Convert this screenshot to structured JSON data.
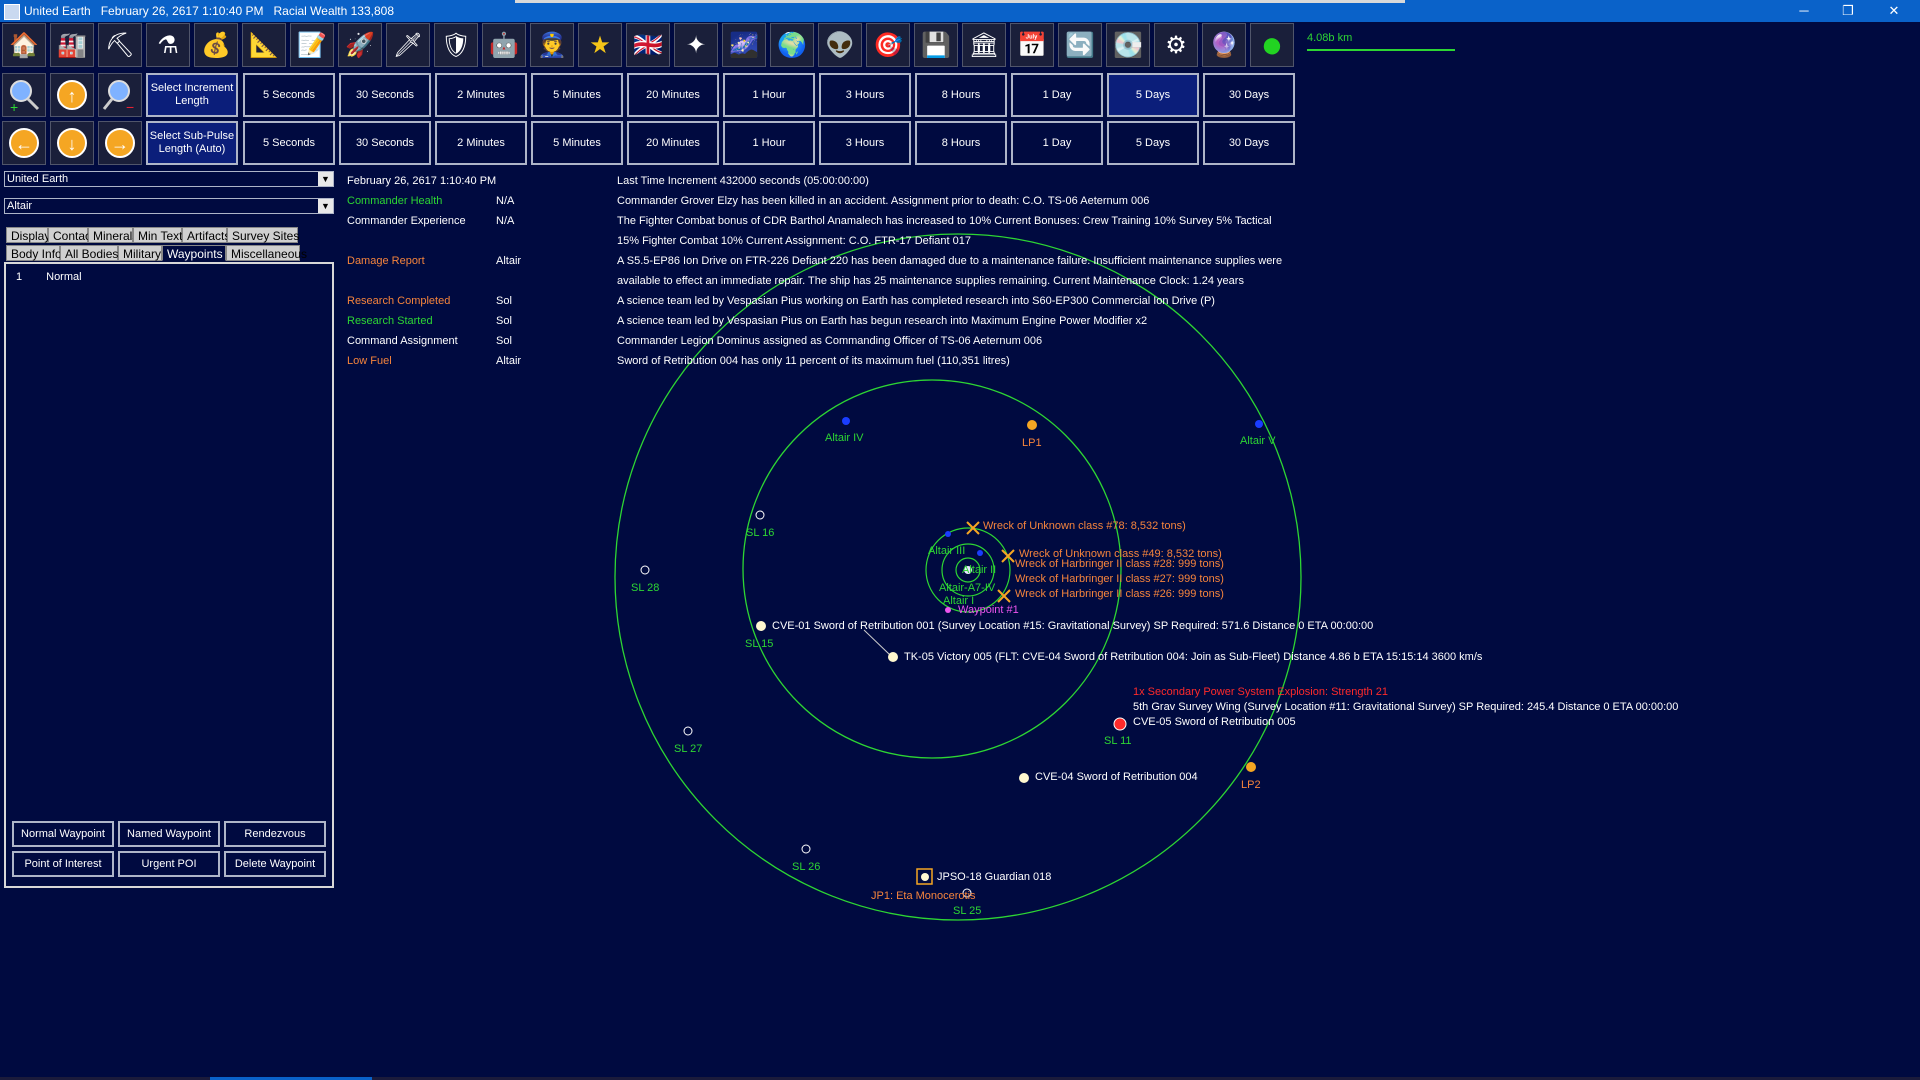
{
  "window": {
    "title": "United Earth   February 26, 2617 1:10:40 PM   Racial Wealth 133,808",
    "minimize": "─",
    "maximize": "❐",
    "close": "✕"
  },
  "toolbar": {
    "icons": [
      "colony-icon",
      "industry-icon",
      "mining-icon",
      "research-icon",
      "wealth-icon",
      "ship-design-icon",
      "production-icon",
      "fleet-icon",
      "missile-icon",
      "ground-forces-icon",
      "ground-units-icon",
      "commander-icon",
      "medal-icon",
      "race-flag-icon",
      "system-map-icon",
      "galaxy-icon",
      "globe-icon",
      "alien-icon",
      "combat-icon",
      "tech-icon",
      "government-icon",
      "calendar-icon",
      "refresh-icon",
      "save-icon",
      "settings-icon",
      "globe-light-icon",
      "green-orb-icon"
    ],
    "distance": "4.08b km"
  },
  "increments": {
    "label": "Select Increment Length",
    "items": [
      "5 Seconds",
      "30 Seconds",
      "2 Minutes",
      "5 Minutes",
      "20 Minutes",
      "1 Hour",
      "3 Hours",
      "8 Hours",
      "1 Day",
      "5 Days",
      "30 Days"
    ],
    "selected": "5 Days"
  },
  "subpulse": {
    "label": "Select Sub-Pulse Length (Auto)",
    "items": [
      "5 Seconds",
      "30 Seconds",
      "2 Minutes",
      "5 Minutes",
      "20 Minutes",
      "1 Hour",
      "3 Hours",
      "8 Hours",
      "1 Day",
      "5 Days",
      "30 Days"
    ]
  },
  "sidebar": {
    "race": "United Earth",
    "system": "Altair",
    "tabs_row1": [
      "Display",
      "Contacts",
      "Minerals",
      "Min Text",
      "Artifacts",
      "Survey Sites"
    ],
    "tabs_row2": [
      "Body Info",
      "All Bodies",
      "Military",
      "Waypoints",
      "Miscellaneous"
    ],
    "active_tab": "Waypoints",
    "waypoint": {
      "num": "1",
      "type": "Normal"
    },
    "buttons": [
      "Normal Waypoint",
      "Named Waypoint",
      "Rendezvous",
      "Point of Interest",
      "Urgent POI",
      "Delete Waypoint"
    ]
  },
  "log": {
    "date": "February 26, 2617 1:10:40 PM",
    "increment": "Last Time Increment 432000 seconds (05:00:00:00)",
    "events": [
      {
        "type": "Commander Health",
        "loc": "N/A",
        "text": "Commander Grover Elzy has been killed in an accident. Assignment prior to death: C.O. TS-06 Aeternum 006",
        "color": "green"
      },
      {
        "type": "Commander Experience",
        "loc": "N/A",
        "text": "The Fighter Combat bonus of CDR Barthol Anamalech has increased to 10%   Current Bonuses:  Crew Training 10%   Survey 5%   Tactical",
        "text2": "15%   Fighter Combat 10%   Current Assignment:  C.O. FTR-17 Defiant 017",
        "color": "white"
      },
      {
        "type": "Damage Report",
        "loc": "Altair",
        "text": "A S5.5-EP86 Ion Drive on FTR-226 Defiant 220 has been damaged due to a maintenance failure. Insufficient maintenance supplies were",
        "text2": "available to effect an immediate repair. The ship has 25 maintenance supplies remaining. Current Maintenance Clock: 1.24 years",
        "color": "orange"
      },
      {
        "type": "Research Completed",
        "loc": "Sol",
        "text": "A science team led by Vespasian Pius working on Earth has completed research into S60-EP300 Commercial Ion Drive (P)",
        "color": "orange"
      },
      {
        "type": "Research Started",
        "loc": "Sol",
        "text": "A science team led by Vespasian Pius on Earth has begun research into Maximum Engine Power Modifier x2",
        "color": "green"
      },
      {
        "type": "Command Assignment",
        "loc": "Sol",
        "text": "Commander Legion Dominus assigned as Commanding Officer of TS-06 Aeternum 006",
        "color": "white"
      },
      {
        "type": "Low Fuel",
        "loc": "Altair",
        "text": "Sword of Retribution 004 has only 11 percent of its maximum fuel (110,351 litres)",
        "color": "orange"
      }
    ]
  },
  "map": {
    "bodies": [
      "Altair IV",
      "LP1",
      "Altair V",
      "Altair III",
      "Altair II",
      "Altair I",
      "Altair-A7-IV",
      "LP2"
    ],
    "waypoint": "Waypoint #1",
    "survey_sites": [
      "SL 16",
      "SL 28",
      "SL 15",
      "SL 27",
      "SL 11",
      "SL 26",
      "SL 25"
    ],
    "wrecks": [
      "Wreck of Unknown class  #78: 8,532 tons)",
      "Wreck of Unknown class  #49: 8,532 tons)",
      "Wreck of Harbringer II class  #28: 999 tons)",
      "Wreck of Harbringer II class  #27: 999 tons)",
      "Wreck of Harbringer II class  #26: 999 tons)"
    ],
    "fleets": {
      "cve01": "CVE-01 Sword of Retribution 001  (Survey Location #15: Gravitational Survey)  SP Required: 571.6   Distance 0   ETA 00:00:00",
      "tk05": "TK-05 Victory 005  (FLT: CVE-04 Sword of Retribution 004: Join as Sub-Fleet)  Distance 4.86 b   ETA 15:15:14   3600 km/s",
      "explosion": "1x Secondary Power System Explosion: Strength 21",
      "wing": "5th Grav Survey Wing  (Survey Location #11: Gravitational Survey)  SP Required: 245.4   Distance 0   ETA 00:00:00",
      "cve05": "CVE-05 Sword of Retribution 005",
      "cve04": "CVE-04 Sword of Retribution 004",
      "jpso": "JPSO-18 Guardian 018",
      "jp1": "JP1: Eta Monocerotis"
    }
  }
}
